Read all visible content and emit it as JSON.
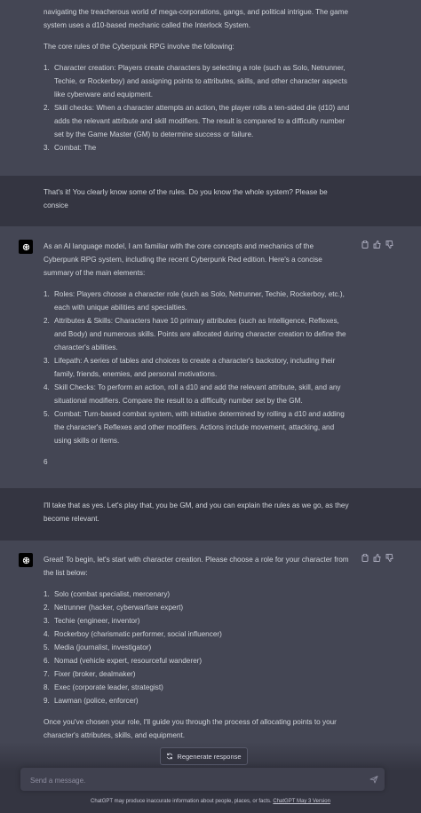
{
  "messages": {
    "m1": {
      "p1": "navigating the treacherous world of mega-corporations, gangs, and political intrigue. The game system uses a d10-based mechanic called the Interlock System.",
      "p2": "The core rules of the Cyberpunk RPG involve the following:",
      "items": [
        {
          "num": "1.",
          "text": "Character creation: Players create characters by selecting a role (such as Solo, Netrunner, Techie, or Rockerboy) and assigning points to attributes, skills, and other character aspects like cyberware and equipment."
        },
        {
          "num": "2.",
          "text": "Skill checks: When a character attempts an action, the player rolls a ten-sided die (d10) and adds the relevant attribute and skill modifiers. The result is compared to a difficulty number set by the Game Master (GM) to determine success or failure."
        },
        {
          "num": "3.",
          "text": "Combat: The"
        }
      ]
    },
    "u1": {
      "text": "That's it! You clearly know some of the rules. Do you know the whole system? Please be consice"
    },
    "m2": {
      "p1": "As an AI language model, I am familiar with the core concepts and mechanics of the Cyberpunk RPG system, including the recent Cyberpunk Red edition. Here's a concise summary of the main elements:",
      "items": [
        {
          "num": "1.",
          "text": "Roles: Players choose a character role (such as Solo, Netrunner, Techie, Rockerboy, etc.), each with unique abilities and specialties."
        },
        {
          "num": "2.",
          "text": "Attributes & Skills: Characters have 10 primary attributes (such as Intelligence, Reflexes, and Body) and numerous skills. Points are allocated during character creation to define the character's abilities."
        },
        {
          "num": "3.",
          "text": "Lifepath: A series of tables and choices to create a character's backstory, including their family, friends, enemies, and personal motivations."
        },
        {
          "num": "4.",
          "text": "Skill Checks: To perform an action, roll a d10 and add the relevant attribute, skill, and any situational modifiers. Compare the result to a difficulty number set by the GM."
        },
        {
          "num": "5.",
          "text": "Combat: Turn-based combat system, with initiative determined by rolling a d10 and adding the character's Reflexes and other modifiers. Actions include movement, attacking, and using skills or items."
        }
      ],
      "p2": "6"
    },
    "u2": {
      "text": "I'll take that as yes. Let's play that, you be GM, and you can explain the rules as we go, as they become relevant."
    },
    "m3": {
      "p1": "Great! To begin, let's start with character creation. Please choose a role for your character from the list below:",
      "items": [
        {
          "num": "1.",
          "text": "Solo (combat specialist, mercenary)"
        },
        {
          "num": "2.",
          "text": "Netrunner (hacker, cyberwarfare expert)"
        },
        {
          "num": "3.",
          "text": "Techie (engineer, inventor)"
        },
        {
          "num": "4.",
          "text": "Rockerboy (charismatic performer, social influencer)"
        },
        {
          "num": "5.",
          "text": "Media (journalist, investigator)"
        },
        {
          "num": "6.",
          "text": "Nomad (vehicle expert, resourceful wanderer)"
        },
        {
          "num": "7.",
          "text": "Fixer (broker, dealmaker)"
        },
        {
          "num": "8.",
          "text": "Exec (corporate leader, strategist)"
        },
        {
          "num": "9.",
          "text": "Lawman (police, enforcer)"
        }
      ],
      "p2": "Once you've chosen your role, I'll guide you through the process of allocating points to your character's attributes, skills, and equipment."
    }
  },
  "controls": {
    "regenerate_label": "Regenerate response",
    "input_placeholder": "Send a message.",
    "footer_text": "ChatGPT may produce inaccurate information about people, places, or facts.",
    "footer_link": "ChatGPT May 3 Version"
  },
  "icons": {
    "copy": "clipboard-icon",
    "like": "thumbs-up-icon",
    "dislike": "thumbs-down-icon",
    "regenerate": "refresh-icon",
    "send": "paper-plane-icon",
    "avatar": "openai-logo-icon"
  },
  "colors": {
    "assistant_bg": "#444654",
    "user_bg": "#343541",
    "text": "#d1d5db",
    "input_bg": "#40414f"
  }
}
